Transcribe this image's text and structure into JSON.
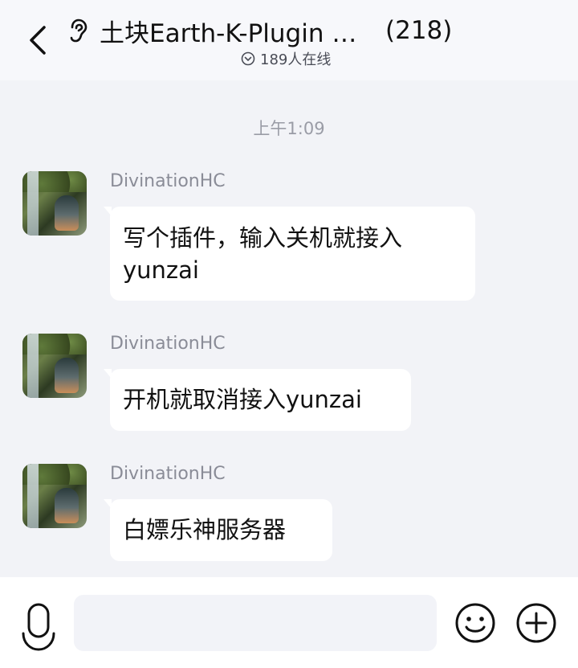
{
  "header": {
    "back_icon": "chevron-left-icon",
    "ear_icon": "ear-icon",
    "group_name": "土块Earth-K-Plugin &…",
    "member_count": "(218)",
    "online_icon": "chevron-down-circle-icon",
    "online_text": "189人在线"
  },
  "chat": {
    "time_divider": "上午1:09",
    "messages": [
      {
        "sender": "DivinationHC",
        "text_line1": "写个插件，输入关机就接入",
        "text_line2": "yunzai"
      },
      {
        "sender": "DivinationHC",
        "text": "开机就取消接入yunzai"
      },
      {
        "sender": "DivinationHC",
        "text": "白嫖乐神服务器"
      }
    ]
  },
  "footer": {
    "mic_icon": "microphone-icon",
    "input_value": "",
    "input_placeholder": "",
    "emoji_icon": "smiley-icon",
    "plus_icon": "plus-circle-icon"
  },
  "colors": {
    "background": "#f2f3f7",
    "bubble": "#ffffff",
    "sender_text": "#8a8c97",
    "time_text": "#9a9ca6"
  }
}
